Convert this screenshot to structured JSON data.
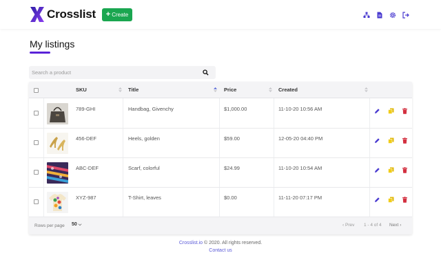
{
  "header": {
    "brand": "Crosslist",
    "create_label": "Create",
    "icons": [
      "network-icon",
      "document-icon",
      "settings-icon",
      "logout-icon"
    ]
  },
  "page": {
    "title": "My listings",
    "accent_color": "#5a22d8"
  },
  "search": {
    "placeholder": "Search a product"
  },
  "table": {
    "columns": [
      "SKU",
      "Title",
      "Price",
      "Created"
    ],
    "rows": [
      {
        "sku": "789-GHI",
        "title": "Handbag, Givenchy",
        "price": "$1,000.00",
        "created": "11-10-20 10:56 AM",
        "image": "handbag"
      },
      {
        "sku": "456-DEF",
        "title": "Heels, golden",
        "price": "$59.00",
        "created": "12-05-20 04:40 PM",
        "image": "heels"
      },
      {
        "sku": "ABC-DEF",
        "title": "Scarf, colorful",
        "price": "$24.99",
        "created": "11-10-20 10:54 AM",
        "image": "scarf"
      },
      {
        "sku": "XYZ-987",
        "title": "T-Shirt, leaves",
        "price": "$0.00",
        "created": "11-11-20 07:17 PM",
        "image": "tshirt"
      }
    ],
    "footer": {
      "rows_per_page_label": "Rows per page",
      "rows_per_page_value": "50",
      "prev_label": "Prev",
      "range_label": "1 - 4 of 4",
      "next_label": "Next"
    }
  },
  "footer": {
    "brand_link": "Crosslist.io",
    "copyright": " © 2020. All rights reserved.",
    "contact_label": "Contact us"
  }
}
